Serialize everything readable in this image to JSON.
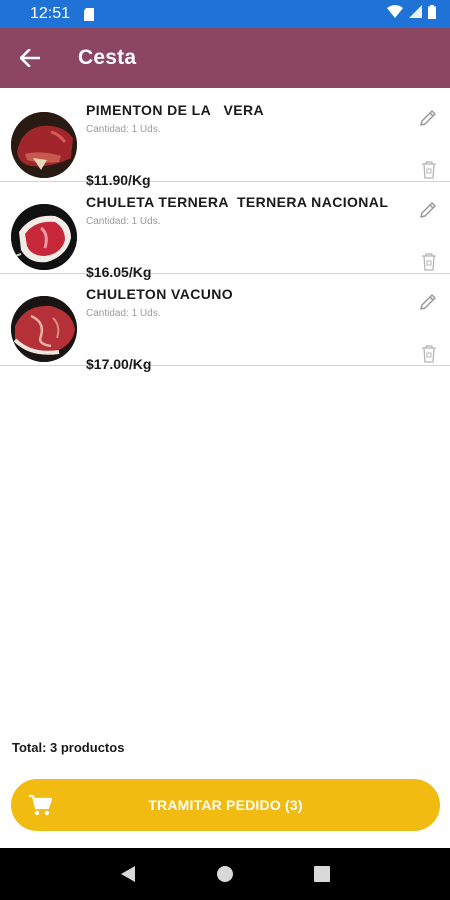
{
  "status_bar": {
    "time": "12:51",
    "icons": [
      "sd-card-icon",
      "wifi-icon",
      "cell-signal-icon",
      "battery-icon"
    ]
  },
  "app_bar": {
    "title": "Cesta",
    "back_icon": "arrow-left-icon",
    "color": "#8d4661"
  },
  "items": [
    {
      "name": "PIMENTON DE LA   VERA",
      "quantity": "Cantidad: 1 Uds.",
      "price": "$11.90/Kg",
      "image": "meat-thumbnail"
    },
    {
      "name": "CHULETA TERNERA  TERNERA NACIONAL",
      "quantity": "Cantidad: 1 Uds.",
      "price": "$16.05/Kg",
      "image": "meat-thumbnail"
    },
    {
      "name": "CHULETON VACUNO",
      "quantity": "Cantidad: 1 Uds.",
      "price": "$17.00/Kg",
      "image": "meat-thumbnail"
    }
  ],
  "footer": {
    "total": "Total: 3 productos",
    "order_button": "TRAMITAR PEDIDO (3)",
    "button_color": "#f2bb12"
  },
  "nav_bar": {
    "icons": [
      "back-triangle-icon",
      "home-circle-icon",
      "recents-square-icon"
    ]
  }
}
